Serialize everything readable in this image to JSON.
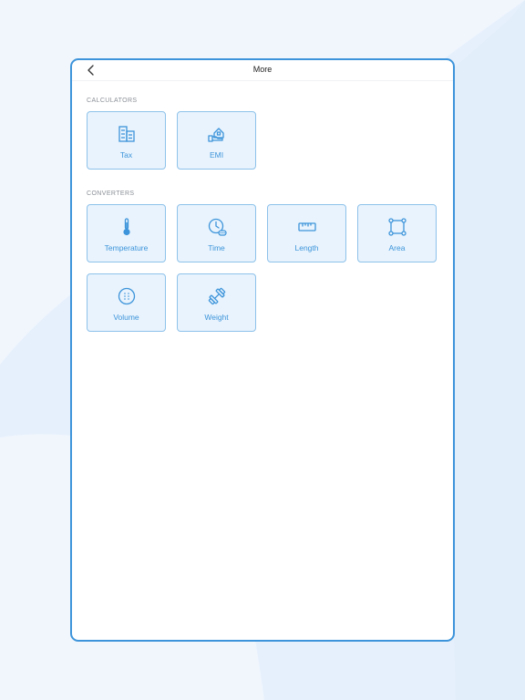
{
  "header": {
    "title": "More"
  },
  "sections": {
    "calculators": {
      "label": "CALCULATORS",
      "items": [
        {
          "label": "Tax",
          "icon": "building-icon"
        },
        {
          "label": "EMI",
          "icon": "house-hand-icon"
        }
      ]
    },
    "converters": {
      "label": "CONVERTERS",
      "items": [
        {
          "label": "Temperature",
          "icon": "thermometer-icon"
        },
        {
          "label": "Time",
          "icon": "clock-icon"
        },
        {
          "label": "Length",
          "icon": "ruler-icon"
        },
        {
          "label": "Area",
          "icon": "area-square-icon"
        },
        {
          "label": "Volume",
          "icon": "volume-dots-icon"
        },
        {
          "label": "Weight",
          "icon": "dumbbell-icon"
        }
      ]
    }
  },
  "colors": {
    "accent": "#3d94da",
    "tile_background": "#e8f3fd",
    "tile_border": "#8ec2ea",
    "page_background": "#f1f6fd"
  }
}
